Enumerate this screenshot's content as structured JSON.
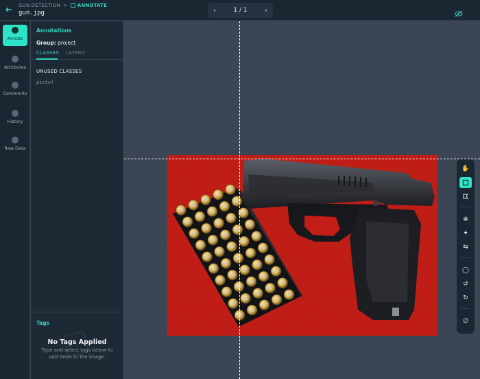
{
  "header": {
    "breadcrumb_project": "GUN DETECTION",
    "breadcrumb_separator": ">",
    "breadcrumb_mode": "ANNOTATE",
    "filename": "gun.jpg",
    "pager": "1 / 1"
  },
  "rail": [
    {
      "label": "Annots",
      "icon": "annotation-icon",
      "active": true
    },
    {
      "label": "Attributes",
      "icon": "attributes-icon",
      "active": false
    },
    {
      "label": "Comments",
      "icon": "comment-icon",
      "active": false
    },
    {
      "label": "History",
      "icon": "history-icon",
      "active": false
    },
    {
      "label": "Raw Data",
      "icon": "raw-data-icon",
      "active": false
    }
  ],
  "panel": {
    "title": "Annotations",
    "group_label": "Group:",
    "group_value": "project",
    "tab_classes": "CLASSES",
    "tab_layers": "LAYERS",
    "unused_classes": "UNUSED CLASSES",
    "class_name": "pistol",
    "tags_title": "Tags",
    "no_tags": "No Tags Applied",
    "no_tags_help": "Type and select tags below to add them to the image."
  },
  "colors": {
    "accent": "#2de3c8",
    "background": "#3b4554",
    "panel": "#1e2936"
  },
  "toolbar": [
    "pan-hand-icon",
    "bounding-box-icon",
    "polygon-icon",
    "smart-select-icon",
    "magic-wand-icon",
    "repeat-icon",
    "comment-icon",
    "undo-icon",
    "redo-icon",
    "hide-icon"
  ]
}
